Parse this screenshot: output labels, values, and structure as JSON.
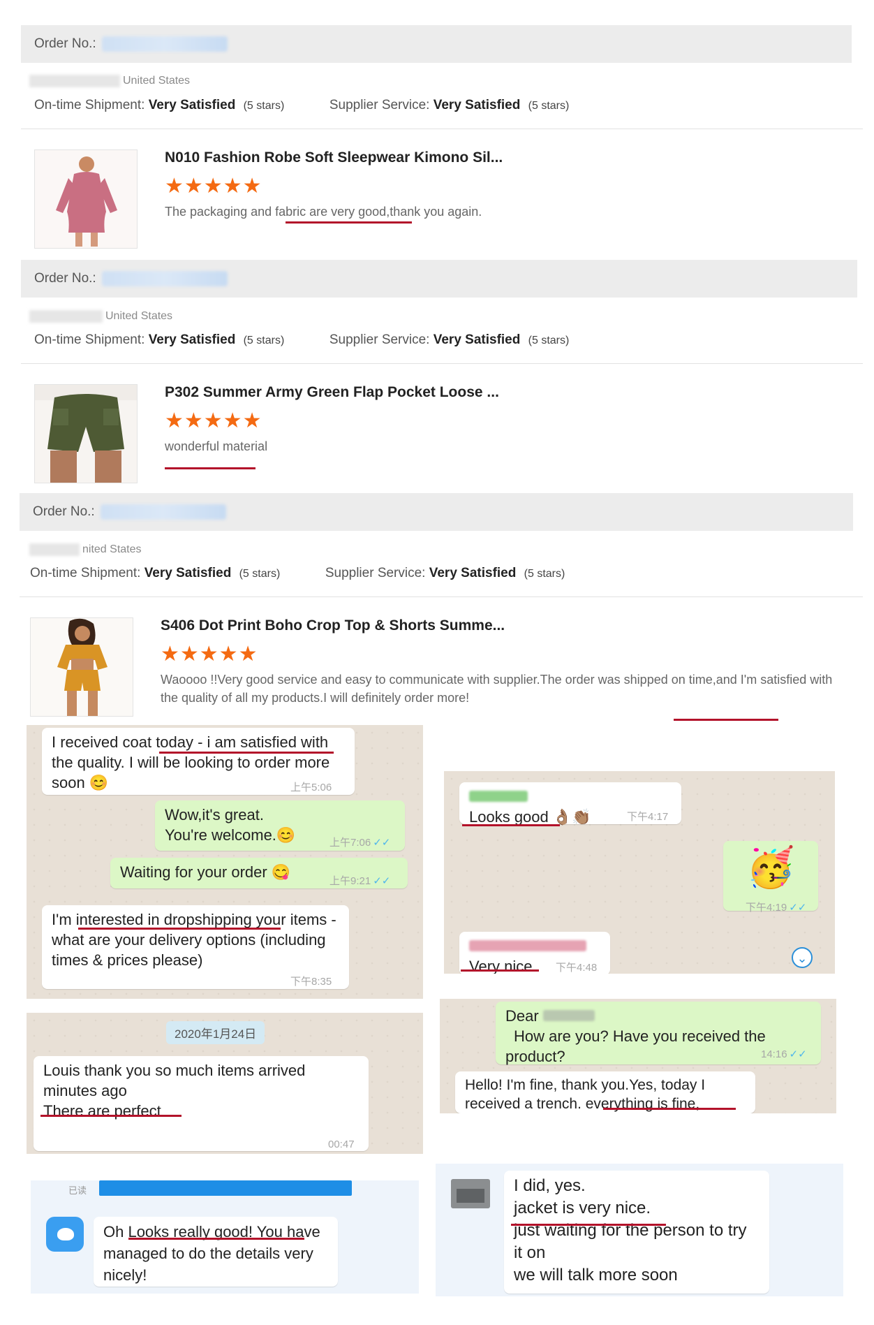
{
  "reviews": [
    {
      "order_label": "Order No.:",
      "country": "United States",
      "shipment_label": "On-time Shipment:",
      "shipment_value": "Very Satisfied",
      "shipment_stars": "(5 stars)",
      "supplier_label": "Supplier Service:",
      "supplier_value": "Very Satisfied",
      "supplier_stars": "(5 stars)",
      "product_title": "N010 Fashion Robe Soft Sleepwear Kimono Sil...",
      "rating": 5,
      "stars": "★★★★★",
      "comment": "The packaging and fabric are very good,thank you again."
    },
    {
      "order_label": "Order No.:",
      "country": "United States",
      "shipment_label": "On-time Shipment:",
      "shipment_value": "Very Satisfied",
      "shipment_stars": "(5 stars)",
      "supplier_label": "Supplier Service:",
      "supplier_value": "Very Satisfied",
      "supplier_stars": "(5 stars)",
      "product_title": "P302 Summer Army Green Flap Pocket Loose ...",
      "rating": 5,
      "stars": "★★★★★",
      "comment": "wonderful material"
    },
    {
      "order_label": "Order No.:",
      "country": "nited States",
      "shipment_label": "On-time Shipment:",
      "shipment_value": "Very Satisfied",
      "shipment_stars": "(5 stars)",
      "supplier_label": "Supplier Service:",
      "supplier_value": "Very Satisfied",
      "supplier_stars": "(5 stars)",
      "product_title": "S406 Dot Print Boho Crop Top & Shorts Summe...",
      "rating": 5,
      "stars": "★★★★★",
      "comment": "Waoooo !!Very good service and easy to communicate with supplier.The order was shipped on time,and I'm satisfied with the quality of all my products.I will definitely order more!"
    }
  ],
  "chat1": {
    "m1": "I received coat today - i am satisfied with the quality. I will be looking to order more soon 😊",
    "t1": "上午5:06",
    "m2a": "Wow,it's great.",
    "m2b": "You're welcome.😊",
    "t2": "上午7:06",
    "m3": "Waiting for your order 😋",
    "t3": "上午9:21",
    "m4": "I'm interested in dropshipping your items - what are your delivery options (including times & prices please)",
    "t4": "下午8:35"
  },
  "chat2": {
    "m1": "Looks good 👌🏽👏🏽",
    "t1": "下午4:17",
    "sticker": "🥳",
    "t2": "下午4:19",
    "m3": "Very nice",
    "t3": "下午4:48"
  },
  "chat3": {
    "date": "2020年1月24日",
    "m1": "Louis thank you so much items arrived minutes ago",
    "m1b": "There are perfect",
    "t1": "00:47"
  },
  "chat4": {
    "m1a": "Dear",
    "m1b": "How are you? Have you received the",
    "m1c": "product?",
    "t1": "14:16",
    "m2": "Hello! I'm fine, thank you.Yes, today I received a trench.  everything is fine,"
  },
  "chat5": {
    "read_label": "已读",
    "m1": "Oh Looks really good! You have managed to do the details very nicely!"
  },
  "chat6": {
    "l1": "I did, yes.",
    "l2": "jacket is very nice.",
    "l3": "just waiting for the person to try it on",
    "l4": "we will talk more soon"
  },
  "colors": {
    "star": "#f46a12",
    "underline": "#b3122a",
    "wa_green": "#dcf7c6",
    "tick_blue": "#4fb6ec"
  }
}
